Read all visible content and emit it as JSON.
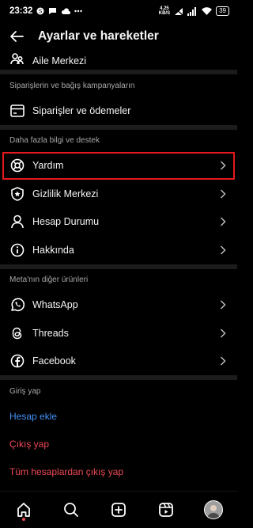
{
  "status_bar": {
    "time": "23:32",
    "speed_value": "4,25",
    "speed_unit": "KB/S",
    "battery": "39",
    "network": "5G"
  },
  "header": {
    "title": "Ayarlar ve hareketler"
  },
  "top_partial": {
    "label": "Aile Merkezi"
  },
  "sections": {
    "orders": {
      "title": "Siparişlerin ve bağış kampanyaların",
      "item": "Siparişler ve ödemeler"
    },
    "support": {
      "title": "Daha fazla bilgi ve destek",
      "items": [
        "Yardım",
        "Gizlilik Merkezi",
        "Hesap Durumu",
        "Hakkında"
      ]
    },
    "meta": {
      "title": "Meta'nın diğer ürünleri",
      "items": [
        "WhatsApp",
        "Threads",
        "Facebook"
      ]
    },
    "login": {
      "title": "Giriş yap",
      "add_account": "Hesap ekle",
      "logout": "Çıkış yap",
      "logout_all": "Tüm hesaplardan çıkış yap"
    }
  },
  "colors": {
    "highlight": "#e3191e",
    "link_blue": "#4191f5",
    "danger_red": "#ed4956"
  }
}
